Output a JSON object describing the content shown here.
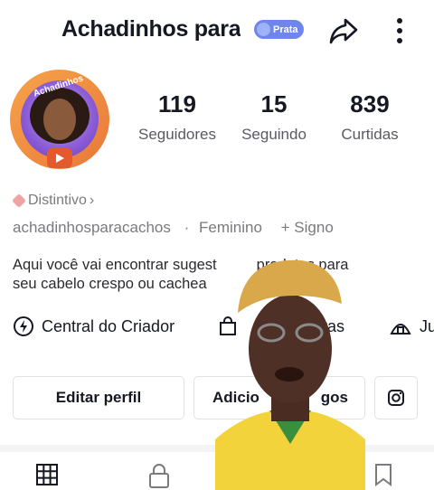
{
  "header": {
    "title": "Achadinhos para",
    "badge_label": "Prata",
    "share_icon": "share-arrow-icon",
    "more_icon": "more-vertical-icon"
  },
  "avatar": {
    "arc_text": "Achadinhos"
  },
  "stats": [
    {
      "value": "119",
      "label": "Seguidores"
    },
    {
      "value": "15",
      "label": "Seguindo"
    },
    {
      "value": "839",
      "label": "Curtidas"
    }
  ],
  "profile": {
    "distintivo_label": "Distintivo",
    "username": "achadinhosparacachos",
    "gender": "Feminino",
    "add_sign": "+ Signo",
    "bio_line1": "Aqui você vai encontrar sugest",
    "bio_line1_end": "produtos para",
    "bio_line2": "seu cabelo crespo ou cachea"
  },
  "chips": [
    {
      "label": "Central do Criador",
      "icon": "lightning-icon"
    },
    {
      "label": "oras",
      "icon": "shopping-bag-icon"
    },
    {
      "label": "Ju",
      "icon": "tent-icon"
    }
  ],
  "buttons": {
    "edit": "Editar perfil",
    "add_left": "Adicio",
    "add_right": "gos",
    "instagram_icon": "instagram-icon"
  },
  "tabs": [
    {
      "icon": "grid-icon"
    },
    {
      "icon": "lock-icon"
    },
    {
      "icon": "bookmark-icon"
    }
  ],
  "colors": {
    "badge_bg": "#6e86ec",
    "avatar_ring": "#f7a44a",
    "text_primary": "#161823",
    "text_secondary": "#7a7a80"
  }
}
